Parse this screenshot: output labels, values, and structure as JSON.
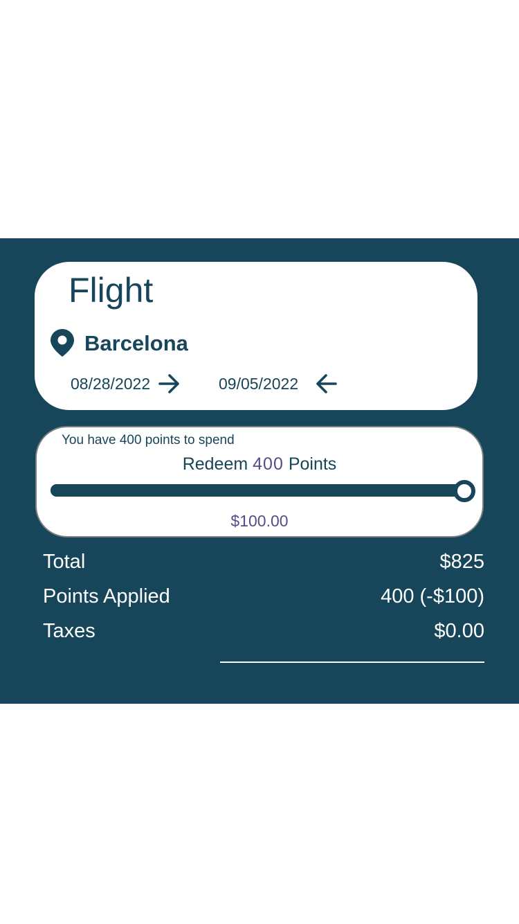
{
  "colors": {
    "panel_background": "#174559",
    "card_background": "#ffffff",
    "primary_text": "#174559",
    "accent_value": "#5a4a8a",
    "summary_text": "#ffffff"
  },
  "flight": {
    "title": "Flight",
    "location_icon": "map-pin-icon",
    "city": "Barcelona",
    "depart_date": "08/28/2022",
    "depart_icon": "arrow-right-icon",
    "return_date": "09/05/2022",
    "return_icon": "arrow-left-icon"
  },
  "points": {
    "available_text": "You have 400 points to spend",
    "redeem_prefix": "Redeem",
    "redeem_value": "400",
    "redeem_suffix": "Points",
    "slider_fraction": 1.0,
    "dollar_value": "$100.00"
  },
  "summary": {
    "total_label": "Total",
    "total_value": "$825",
    "points_label": "Points Applied",
    "points_value": "400 (-$100)",
    "taxes_label": "Taxes",
    "taxes_value": "$0.00"
  }
}
